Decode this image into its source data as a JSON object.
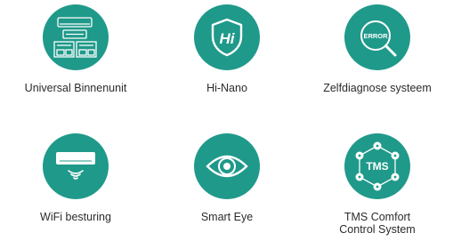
{
  "accent_color": "#1f998a",
  "features": [
    {
      "label": "Universal Binnenunit",
      "icon": "indoor-units-icon"
    },
    {
      "label": "Hi-Nano",
      "icon": "hi-nano-shield-icon"
    },
    {
      "label": "Zelfdiagnose systeem",
      "icon": "error-magnifier-icon"
    },
    {
      "label": "WiFi besturing",
      "icon": "wifi-ac-unit-icon"
    },
    {
      "label": "Smart Eye",
      "icon": "smart-eye-icon"
    },
    {
      "label": "TMS Comfort\nControl System",
      "icon": "tms-hexagon-icon",
      "icon_text": "TMS"
    }
  ],
  "error_badge_text": "ERROR",
  "hi_text": "Hi"
}
